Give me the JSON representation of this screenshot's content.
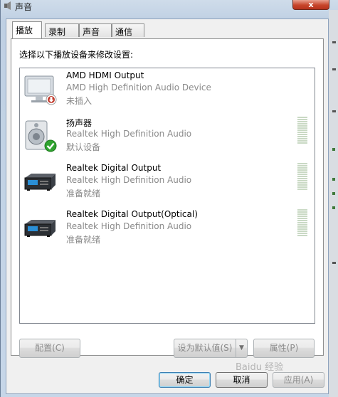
{
  "window": {
    "title": "声音",
    "close_glyph": "x"
  },
  "tabs": [
    {
      "label": "播放",
      "active": true
    },
    {
      "label": "录制",
      "active": false
    },
    {
      "label": "声音",
      "active": false
    },
    {
      "label": "通信",
      "active": false
    }
  ],
  "instruction": "选择以下播放设备来修改设置:",
  "devices": [
    {
      "name": "AMD HDMI Output",
      "description": "AMD High Definition Audio Device",
      "status": "未插入",
      "icon": "monitor-icon",
      "badge": "unplugged-badge"
    },
    {
      "name": "扬声器",
      "description": "Realtek High Definition Audio",
      "status": "默认设备",
      "icon": "speaker-icon",
      "badge": "default-check-badge"
    },
    {
      "name": "Realtek Digital Output",
      "description": "Realtek High Definition Audio",
      "status": "准备就绪",
      "icon": "digital-output-icon",
      "badge": ""
    },
    {
      "name": "Realtek Digital Output(Optical)",
      "description": "Realtek High Definition Audio",
      "status": "准备就绪",
      "icon": "digital-output-icon",
      "badge": ""
    }
  ],
  "buttons": {
    "configure": "配置(C)",
    "set_default": "设为默认值(S)",
    "properties": "属性(P)",
    "ok": "确定",
    "cancel": "取消",
    "apply": "应用(A)"
  },
  "watermark": "Baidu 经验",
  "colors": {
    "accent": "#3c7fb1",
    "disabled_text": "#8a8a8a",
    "check_green": "#2fa32f",
    "unplug_red": "#c0392b"
  }
}
